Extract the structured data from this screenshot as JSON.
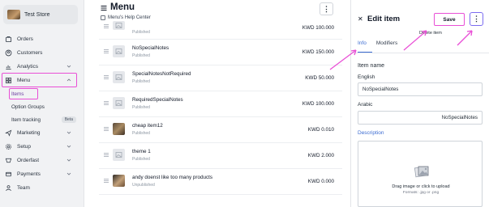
{
  "sidebar": {
    "store_name": "Test Store",
    "items": [
      {
        "label": "Orders",
        "icon": "orders-icon"
      },
      {
        "label": "Customers",
        "icon": "customers-icon"
      },
      {
        "label": "Analytics",
        "icon": "analytics-icon"
      },
      {
        "label": "Menu",
        "icon": "menu-grid-icon"
      },
      {
        "label": "Marketing",
        "icon": "marketing-icon"
      },
      {
        "label": "Setup",
        "icon": "gear-icon"
      },
      {
        "label": "Orderfast",
        "icon": "orderfast-icon"
      },
      {
        "label": "Payments",
        "icon": "payments-icon"
      },
      {
        "label": "Team",
        "icon": "team-icon"
      }
    ],
    "menu_sub": [
      {
        "label": "Items"
      },
      {
        "label": "Option Groups"
      },
      {
        "label": "Item tracking",
        "badge": "Beta"
      }
    ]
  },
  "main": {
    "title": "Menu",
    "help_link": "Menu's Help Center",
    "products": [
      {
        "name": "",
        "status": "Published",
        "price": "KWD 100.000"
      },
      {
        "name": "NoSpecialNotes",
        "status": "Published",
        "price": "KWD 150.000"
      },
      {
        "name": "SpecialNotesNotRequired",
        "status": "Published",
        "price": "KWD 50.000"
      },
      {
        "name": "RequiredSpecialNotes",
        "status": "Published",
        "price": "KWD 100.000"
      },
      {
        "name": "cheap item12",
        "status": "Published",
        "price": "KWD 0.010"
      },
      {
        "name": "theme 1",
        "status": "Published",
        "price": "KWD 2.000"
      },
      {
        "name": "andy doenst like too many products",
        "status": "Unpublished",
        "price": "KWD 0.000"
      }
    ]
  },
  "panel": {
    "close": "✕",
    "title": "Edit item",
    "save_label": "Save",
    "more_label": "⋮",
    "tooltip": "Delete item",
    "tabs": [
      {
        "label": "Info"
      },
      {
        "label": "Modifiers"
      }
    ],
    "item_name_label": "Item name",
    "english_label": "English",
    "english_value": "NoSpecialNotes",
    "arabic_label": "Arabic",
    "arabic_value": "NoSpecialNotes",
    "description_label": "Description",
    "upload_text": "Drag image or click to upload",
    "upload_formats": "Formats: .jpg or .png"
  },
  "colors": {
    "highlight": "#e94fd6",
    "accent": "#3b6bd1",
    "more_border": "#7b6cf0"
  }
}
